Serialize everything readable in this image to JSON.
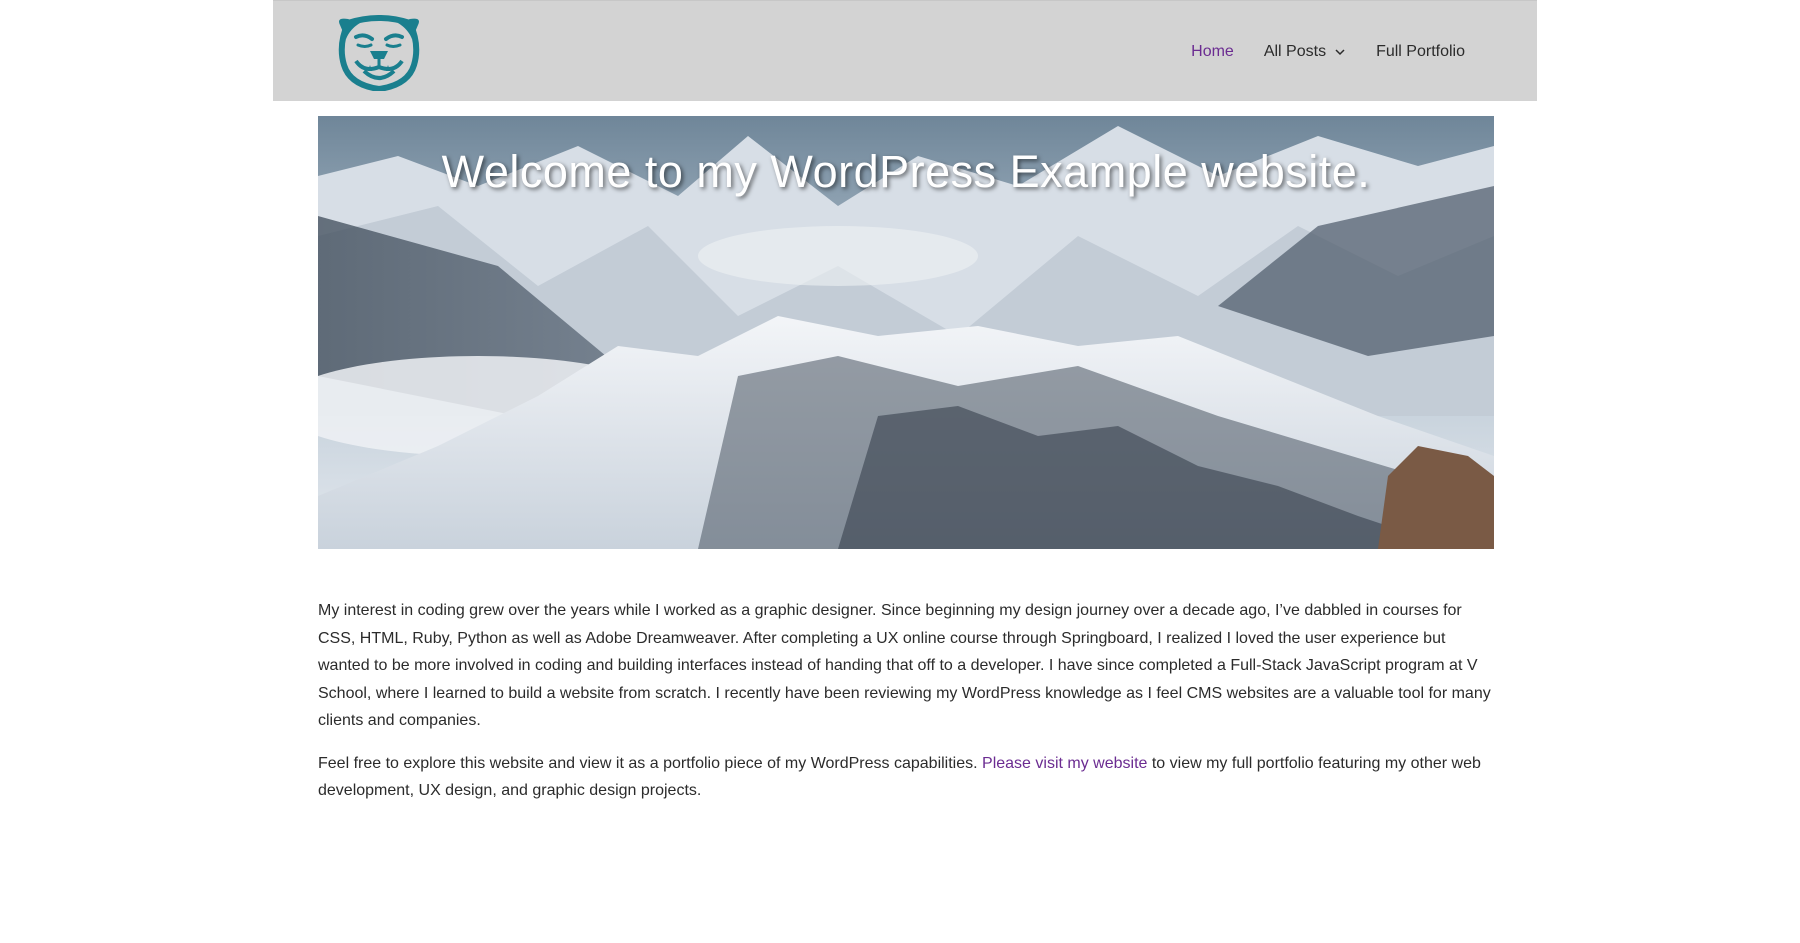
{
  "header": {
    "logo_name": "bulldog-logo",
    "nav": {
      "home": "Home",
      "all_posts": "All Posts",
      "full_portfolio": "Full Portfolio"
    },
    "accent_color": "#6b2c91",
    "header_bg": "#d3d3d3"
  },
  "hero": {
    "title": "Welcome to my WordPress Example website."
  },
  "content": {
    "para1": "My interest in coding grew over the years while I worked as a graphic designer. Since beginning my design journey over a decade ago, I’ve dabbled in courses for CSS, HTML, Ruby, Python as well as Adobe Dreamweaver. After completing a UX online course through Springboard, I realized I loved the user experience but wanted to be more involved in coding and building interfaces instead of handing that off to a developer. I have since completed a Full-Stack JavaScript program at V School, where I learned to build a website from scratch. I recently have been reviewing my WordPress knowledge as I feel CMS websites are a valuable tool for many clients and companies.",
    "para2_before": "Feel free to explore this website and view it as a portfolio piece of my WordPress capabilities. ",
    "para2_link": "Please visit my website",
    "para2_after": " to view my full portfolio featuring my other web development, UX design, and graphic design projects."
  }
}
